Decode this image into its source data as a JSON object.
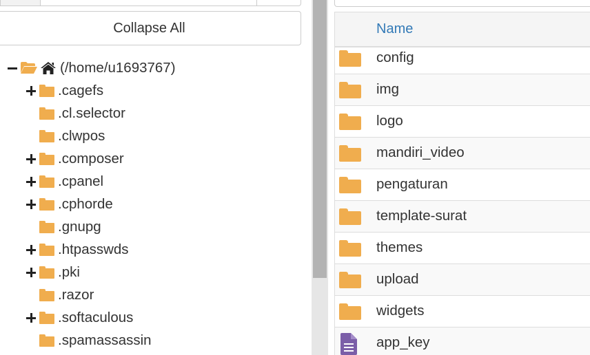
{
  "colors": {
    "folder": "#f0ad4e",
    "file_icon": "#7b5ea8",
    "link_header": "#337ab7",
    "text": "#333333"
  },
  "left_panel": {
    "collapse_label": "Collapse All",
    "root": {
      "label": "(/home/u1693767)",
      "expanded": true,
      "icons": [
        "folder-open-icon",
        "home-icon"
      ]
    },
    "items": [
      {
        "label": ".cagefs",
        "expandable": true
      },
      {
        "label": ".cl.selector",
        "expandable": false
      },
      {
        "label": ".clwpos",
        "expandable": false
      },
      {
        "label": ".composer",
        "expandable": true
      },
      {
        "label": ".cpanel",
        "expandable": true
      },
      {
        "label": ".cphorde",
        "expandable": true
      },
      {
        "label": ".gnupg",
        "expandable": false
      },
      {
        "label": ".htpasswds",
        "expandable": true
      },
      {
        "label": ".pki",
        "expandable": true
      },
      {
        "label": ".razor",
        "expandable": false
      },
      {
        "label": ".softaculous",
        "expandable": true
      },
      {
        "label": ".spamassassin",
        "expandable": false
      }
    ]
  },
  "right_panel": {
    "header": {
      "name": "Name"
    },
    "files": [
      {
        "name": "config",
        "type": "folder",
        "icon": "folder-icon"
      },
      {
        "name": "img",
        "type": "folder",
        "icon": "folder-icon"
      },
      {
        "name": "logo",
        "type": "folder",
        "icon": "folder-icon"
      },
      {
        "name": "mandiri_video",
        "type": "folder",
        "icon": "folder-icon"
      },
      {
        "name": "pengaturan",
        "type": "folder",
        "icon": "folder-icon"
      },
      {
        "name": "template-surat",
        "type": "folder",
        "icon": "folder-icon"
      },
      {
        "name": "themes",
        "type": "folder",
        "icon": "folder-icon"
      },
      {
        "name": "upload",
        "type": "folder",
        "icon": "folder-icon"
      },
      {
        "name": "widgets",
        "type": "folder",
        "icon": "folder-icon"
      },
      {
        "name": "app_key",
        "type": "file",
        "icon": "file-text-icon"
      }
    ]
  }
}
